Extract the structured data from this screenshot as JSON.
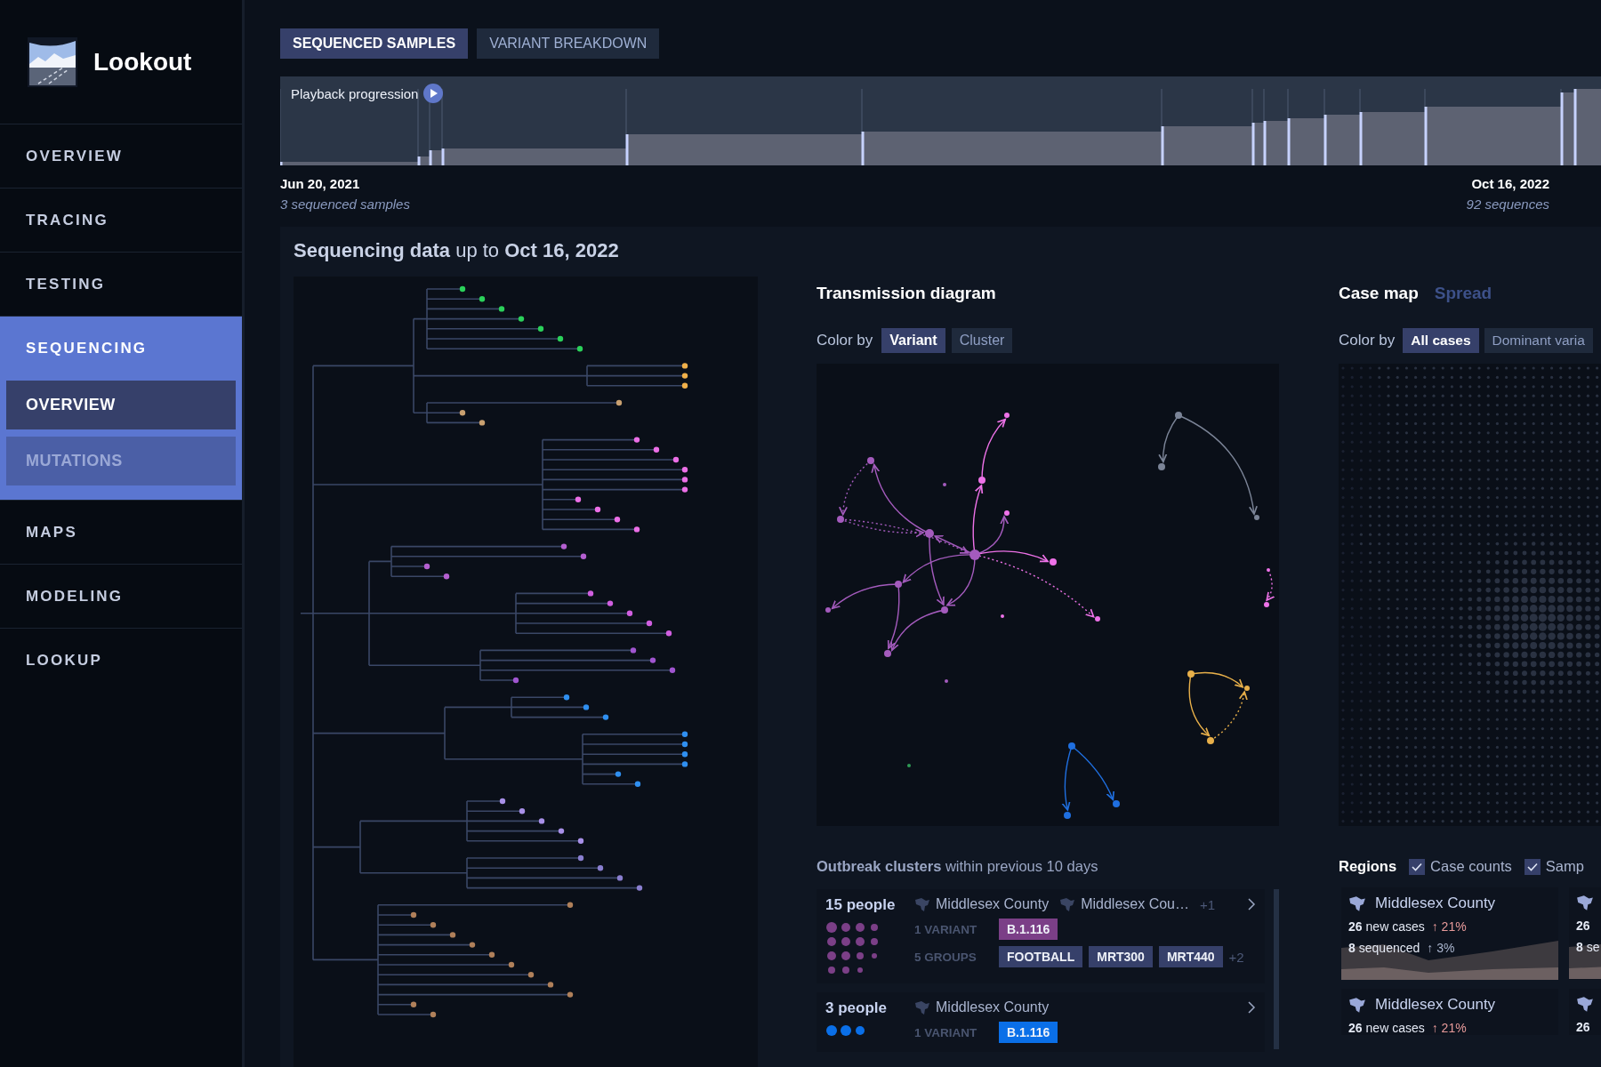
{
  "brand": {
    "name": "Lookout"
  },
  "nav": [
    {
      "label": "OVERVIEW",
      "selected": false
    },
    {
      "label": "TRACING",
      "selected": false
    },
    {
      "label": "TESTING",
      "selected": false
    },
    {
      "label": "SEQUENCING",
      "selected": true,
      "children": [
        {
          "label": "OVERVIEW",
          "selected": true
        },
        {
          "label": "MUTATIONS",
          "selected": false
        }
      ]
    },
    {
      "label": "MAPS",
      "selected": false
    },
    {
      "label": "MODELING",
      "selected": false
    },
    {
      "label": "LOOKUP",
      "selected": false
    }
  ],
  "tabs": [
    {
      "label": "SEQUENCED SAMPLES",
      "selected": true
    },
    {
      "label": "VARIANT BREAKDOWN",
      "selected": false
    }
  ],
  "timeline": {
    "play_label": "Playback progression",
    "start_date": "Jun 20, 2021",
    "start_note": "3 sequenced samples",
    "end_date": "Oct 16, 2022",
    "end_note": "92 sequences"
  },
  "heading": "**Sequencing data** up to **Oct 16, 2022**",
  "transmission": {
    "title": "Transmission diagram",
    "color_by_label": "Color by",
    "options": [
      {
        "label": "Variant",
        "selected": true
      },
      {
        "label": "Cluster",
        "selected": false
      }
    ]
  },
  "outbreak": {
    "title": "**Outbreak clusters** within previous 10 days",
    "clusters": [
      {
        "people": "15 people",
        "color": "#7b3f87",
        "locations": [
          "Middlesex County",
          "Middlesex Cou…"
        ],
        "more_locations": "+1",
        "variant_label": "1 VARIANT",
        "variants": [
          "B.1.116"
        ],
        "groups_label": "5 GROUPS",
        "groups": [
          "FOOTBALL",
          "MRT300",
          "MRT440"
        ],
        "more_groups": "+2"
      },
      {
        "people": "3 people",
        "color": "#0a6fe8",
        "locations": [
          "Middlesex County"
        ],
        "variant_label": "1 VARIANT",
        "variants": [
          "B.1.116"
        ]
      }
    ]
  },
  "case_map": {
    "tabs": [
      {
        "label": "Case map",
        "selected": true
      },
      {
        "label": "Spread",
        "selected": false
      }
    ],
    "color_by_label": "Color by",
    "options": [
      {
        "label": "All cases",
        "selected": true
      },
      {
        "label": "Dominant varia",
        "selected": false
      }
    ]
  },
  "regions": {
    "title": "Regions",
    "toggles": [
      {
        "label": "Case counts",
        "checked": true
      },
      {
        "label": "Samp",
        "checked": true
      }
    ],
    "cards": [
      {
        "name": "Middlesex County",
        "stats": [
          {
            "value": "26",
            "label": "new cases",
            "change": "↑ 21%",
            "color": "#e79a9a"
          },
          {
            "value": "8",
            "label": "sequenced",
            "change": "↑ 3%",
            "color": "#a9b4cc"
          }
        ]
      },
      {
        "stats": [
          {
            "value": "26"
          },
          {
            "value": "8",
            "label": "se"
          }
        ]
      },
      {
        "name": "Middlesex County",
        "stats": [
          {
            "value": "26",
            "label": "new cases",
            "change": "↑ 21%",
            "color": "#e79a9a"
          }
        ]
      },
      {
        "stats": [
          {
            "value": "26"
          }
        ]
      }
    ]
  }
}
